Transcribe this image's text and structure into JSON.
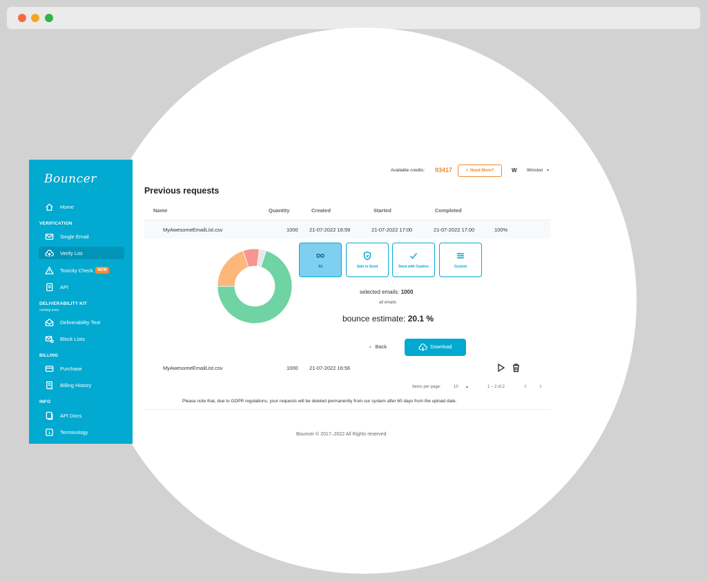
{
  "window": {
    "dots": [
      "#f36b45",
      "#f5a623",
      "#2fb34a"
    ]
  },
  "sidebar": {
    "logo": "Bouncer",
    "home": {
      "label": "Home",
      "icon": "home-icon"
    },
    "sections": {
      "verification": "VERIFICATION",
      "deliverability": "DELIVERABILITY KIT",
      "deliverability_sub": "coming soon",
      "billing": "BILLING",
      "info": "INFO"
    },
    "items": {
      "single_email": "Single Email",
      "verify_list": "Verify List",
      "toxicity_check": "Toxicity Check",
      "toxicity_badge": "NEW",
      "api": "API",
      "deliverability_test": "Deliverability Test",
      "block_lists": "Block Lists",
      "purchase": "Purchase",
      "billing_history": "Billing History",
      "api_docs": "API Docs",
      "terminology": "Terminology"
    },
    "bg_color": "#02a9d0"
  },
  "topbar": {
    "credits_label": "Available credits:",
    "credits_value": "93417",
    "need_more": "Need More?",
    "user_initial": "W",
    "user_name": "Winston"
  },
  "page": {
    "title": "Previous requests"
  },
  "table": {
    "headers": {
      "name": "Name",
      "quantity": "Quantity",
      "created": "Created",
      "started": "Started",
      "completed": "Completed"
    },
    "rows": [
      {
        "name": "MyAwesomeEmailList.csv",
        "quantity": "1000",
        "created": "21-07-2022 16:59",
        "started": "21-07-2022 17:00",
        "completed": "21-07-2022 17:00",
        "progress": "100%"
      },
      {
        "name": "MyAwesomeEmailList.csv",
        "quantity": "1000",
        "created": "21-07-2022 16:56"
      }
    ]
  },
  "details": {
    "filters": [
      "All",
      "Safe to Send",
      "Send with Caution",
      "Custom"
    ],
    "selected_label": "selected emails:",
    "selected_value": "1000",
    "all_emails": "all emails",
    "estimate_label": "bounce estimate:",
    "estimate_value": "20.1 %",
    "back": "Back",
    "download": "Download",
    "donut": [
      {
        "share": 0.7,
        "color": "#6fd3a4"
      },
      {
        "share": 0.2,
        "color": "#fdb77a"
      },
      {
        "share": 0.07,
        "color": "#f79591"
      },
      {
        "share": 0.03,
        "color": "#e7e7e7"
      }
    ]
  },
  "pagination": {
    "items_label": "Items per page:",
    "items_value": "10",
    "range": "1 – 2 of 2"
  },
  "gdpr_note": "Please note that, due to GDPR regulations, your requests will be deleted permanently from our system after 60 days from the upload date.",
  "footer": "Bouncer © 2017–2022 All Rights reserved"
}
